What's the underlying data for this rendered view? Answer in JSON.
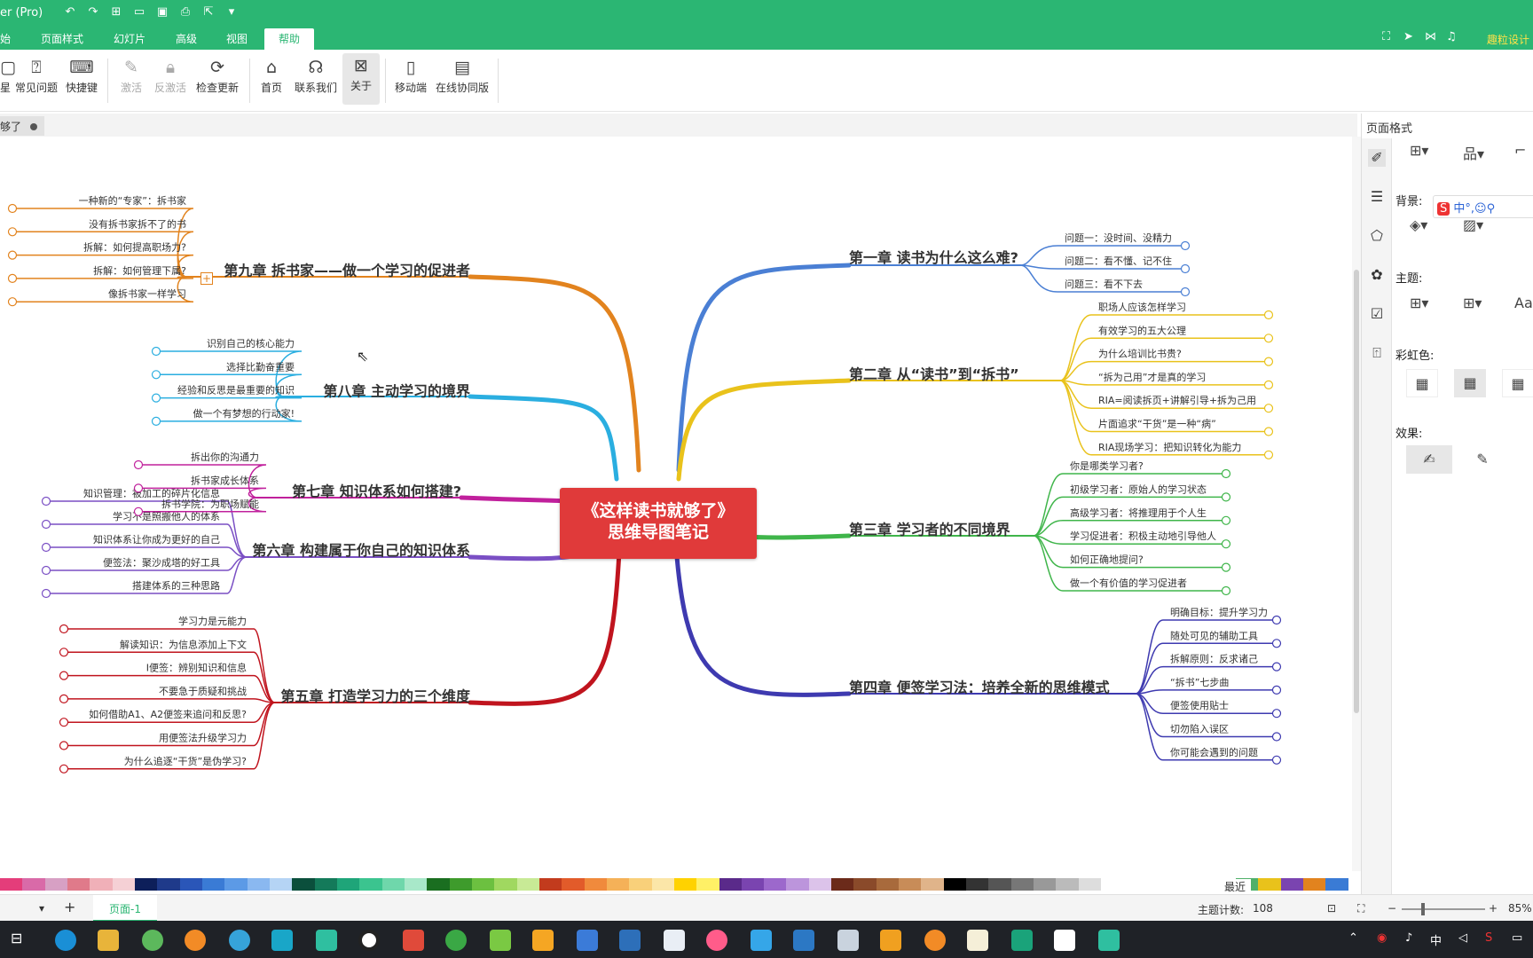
{
  "title_text": "er (Pro)",
  "menus": [
    "始",
    "页面样式",
    "幻灯片",
    "高级",
    "视图",
    "帮助"
  ],
  "active_menu": "帮助",
  "user_name": "趣粒设计",
  "ribbon": [
    {
      "label": "常见问题",
      "icon": "faq-icon",
      "disabled": false
    },
    {
      "label": "快捷键",
      "icon": "keyboard-icon",
      "disabled": false
    },
    {
      "label": "激活",
      "icon": "activate-icon",
      "disabled": true
    },
    {
      "label": "反激活",
      "icon": "lock-icon",
      "disabled": true
    },
    {
      "label": "检查更新",
      "icon": "update-icon",
      "disabled": false
    },
    {
      "label": "首页",
      "icon": "home-icon",
      "disabled": false
    },
    {
      "label": "联系我们",
      "icon": "headset-icon",
      "disabled": false
    },
    {
      "label": "关于",
      "icon": "about-icon",
      "disabled": false
    },
    {
      "label": "移动端",
      "icon": "mobile-icon",
      "disabled": false
    },
    {
      "label": "在线协同版",
      "icon": "browser-icon",
      "disabled": false
    }
  ],
  "ribbon_first_fragment": "星",
  "doc_tab": "够了",
  "root": {
    "line1": "《这样读书就够了》",
    "line2": "思维导图笔记"
  },
  "branches": {
    "ch1": {
      "title": "第一章 读书为什么这么难?",
      "color": "#4a7fd4",
      "items": [
        "问题一：没时间、没精力",
        "问题二：看不懂、记不住",
        "问题三：看不下去"
      ]
    },
    "ch2": {
      "title": "第二章 从“读书”到“拆书”",
      "color": "#e9c21b",
      "items": [
        "职场人应该怎样学习",
        "有效学习的五大公理",
        "为什么培训比书贵?",
        "“拆为己用”才是真的学习",
        "RIA=阅读拆页+讲解引导+拆为己用",
        "片面追求“干货”是一种“病”",
        "RIA现场学习：把知识转化为能力"
      ]
    },
    "ch3": {
      "title": "第三章 学习者的不同境界",
      "color": "#3fb54a",
      "items": [
        "你是哪类学习者?",
        "初级学习者：原始人的学习状态",
        "高级学习者：将推理用于个人生",
        "学习促进者：积极主动地引导他人",
        "如何正确地提问?",
        "做一个有价值的学习促进者"
      ]
    },
    "ch4": {
      "title": "第四章 便签学习法：培养全新的思维模式",
      "color": "#3e3ab0",
      "items": [
        "明确目标：提升学习力",
        "随处可见的辅助工具",
        "拆解原则：反求诸己",
        "“拆书”七步曲",
        "便签使用贴士",
        "切勿陷入误区",
        "你可能会遇到的问题"
      ]
    },
    "ch5": {
      "title": "第五章 打造学习力的三个维度",
      "color": "#c0141e",
      "items": [
        "学习力是元能力",
        "解读知识：为信息添加上下文",
        "I便签：辨别知识和信息",
        "不要急于质疑和挑战",
        "如何借助A1、A2便签来追问和反思?",
        "用便签法升级学习力",
        "为什么追逐“干货”是伪学习?"
      ]
    },
    "ch6": {
      "title": "第六章 构建属于你自己的知识体系",
      "color": "#7a4fc4",
      "items": [
        "知识管理：被加工的碎片化信息",
        "学习不是照搬他人的体系",
        "知识体系让你成为更好的自己",
        "便签法：聚沙成塔的好工具",
        "搭建体系的三种思路"
      ]
    },
    "ch7": {
      "title": "第七章 知识体系如何搭建?",
      "color": "#c0209c",
      "items": [
        "拆出你的沟通力",
        "拆书家成长体系",
        "拆书学院：为职场赋能"
      ]
    },
    "ch8": {
      "title": "第八章 主动学习的境界",
      "color": "#2aaee0",
      "items": [
        "识别自己的核心能力",
        "选择比勤奋重要",
        "经验和反思是最重要的知识",
        "做一个有梦想的行动家!"
      ]
    },
    "ch9": {
      "title": "第九章 拆书家——做一个学习的促进者",
      "color": "#e2831e",
      "items": [
        "一种新的“专家”：拆书家",
        "没有拆书家拆不了的书",
        "拆解：如何提高职场力?",
        "拆解：如何管理下属?",
        "像拆书家一样学习"
      ]
    }
  },
  "panel": {
    "title": "页面格式",
    "background": "背景:",
    "theme": "主题:",
    "rainbow": "彩虹色:",
    "effect": "效果:"
  },
  "recent_label": "最近",
  "page_tab": "页面-1",
  "topic_count_label": "主题计数:",
  "topic_count": "108",
  "zoom": "85%"
}
